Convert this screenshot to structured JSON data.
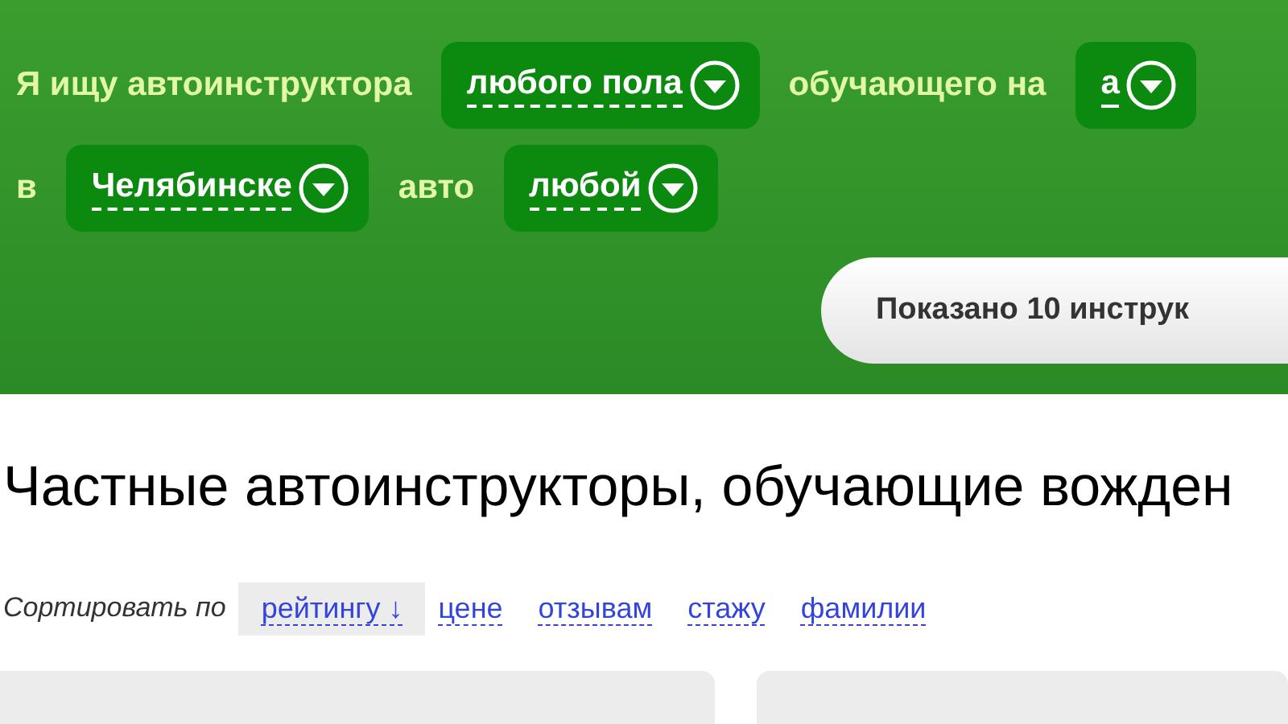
{
  "filter": {
    "lines": [
      [
        {
          "kind": "text",
          "text": "Я ищу автоинструктора"
        },
        {
          "kind": "select",
          "value": "любого пола"
        },
        {
          "kind": "text",
          "text": "обучающего на"
        },
        {
          "kind": "select",
          "value": "а"
        }
      ],
      [
        {
          "kind": "text",
          "text": "в"
        },
        {
          "kind": "select",
          "value": "Челябинске"
        },
        {
          "kind": "text",
          "text": "авто"
        },
        {
          "kind": "select",
          "value": "любой"
        }
      ]
    ]
  },
  "results_button": "Показано 10 инструк",
  "heading": "Частные автоинструкторы, обучающие вожден",
  "sort": {
    "label": "Сортировать по",
    "options": [
      {
        "label": "рейтингу ↓",
        "selected": true
      },
      {
        "label": "цене",
        "selected": false
      },
      {
        "label": "отзывам",
        "selected": false
      },
      {
        "label": "стажу",
        "selected": false
      },
      {
        "label": "фамилии",
        "selected": false
      }
    ]
  }
}
